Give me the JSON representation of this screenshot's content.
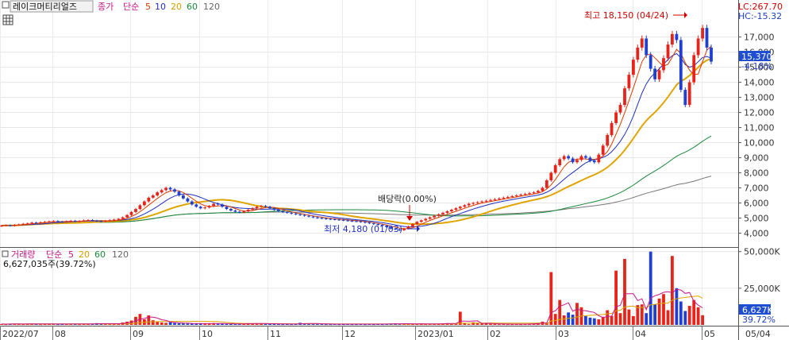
{
  "chart_data": [
    {
      "type": "candlestick",
      "title": "레이크머티리얼즈",
      "legend": {
        "label": "종가",
        "mode": "단순",
        "periods": [
          "5",
          "10",
          "20",
          "60",
          "120"
        ]
      },
      "top_right": {
        "lc": "LC:267.70",
        "hc": "HC:-15.32"
      },
      "price_axis": [
        "17,000",
        "16,000",
        "15,000",
        "14,000",
        "13,000",
        "12,000",
        "11,000",
        "10,000",
        "9,000",
        "8,000",
        "7,000",
        "6,000",
        "5,000",
        "4,000"
      ],
      "ylim": [
        3500,
        18400
      ],
      "current": {
        "price": "15,370",
        "change": "-4.18%"
      },
      "annotations": {
        "high": "최고 18,150 (04/24)",
        "low": "최저 4,180 (01/03)",
        "dividend": "배당락(0.00%)"
      },
      "x_ticks": [
        "2022/07",
        "08",
        "09",
        "10",
        "11",
        "12",
        "2023/01",
        "02",
        "03",
        "04",
        "05",
        "05/04"
      ],
      "close_series": [
        4500,
        4520,
        4490,
        4550,
        4580,
        4620,
        4650,
        4700,
        4680,
        4720,
        4750,
        4780,
        4800,
        4760,
        4740,
        4790,
        4820,
        4780,
        4810,
        4850,
        4870,
        4830,
        4800,
        4780,
        4820,
        4860,
        4900,
        4950,
        5050,
        5200,
        5400,
        5600,
        5850,
        6100,
        6350,
        6500,
        6700,
        6850,
        7000,
        6900,
        6750,
        6500,
        6300,
        6100,
        5900,
        5750,
        5650,
        5700,
        5800,
        5950,
        5900,
        5750,
        5600,
        5500,
        5420,
        5380,
        5450,
        5550,
        5650,
        5750,
        5800,
        5750,
        5650,
        5550,
        5450,
        5400,
        5350,
        5300,
        5250,
        5200,
        5150,
        5100,
        5050,
        5000,
        4980,
        4950,
        4930,
        4900,
        4880,
        4850,
        4820,
        4800,
        4780,
        4750,
        4700,
        4650,
        4600,
        4550,
        4500,
        4400,
        4300,
        4250,
        4200,
        4300,
        4450,
        4600,
        4750,
        4850,
        4950,
        5050,
        5150,
        5250,
        5350,
        5450,
        5550,
        5650,
        5750,
        5850,
        5950,
        6000,
        6050,
        6100,
        6150,
        6200,
        6250,
        6300,
        6350,
        6400,
        6450,
        6500,
        6550,
        6600,
        6650,
        6700,
        6800,
        7000,
        7500,
        8000,
        8500,
        8900,
        9100,
        8950,
        8700,
        8850,
        9100,
        9000,
        8800,
        8700,
        9200,
        9800,
        10500,
        11300,
        12000,
        12500,
        13600,
        14500,
        15500,
        16300,
        16900,
        15800,
        14900,
        14200,
        14800,
        15600,
        16500,
        17200,
        16800,
        13500,
        12500,
        14000,
        15800,
        16900,
        17600,
        16300,
        15370
      ],
      "volume_axis": [
        "50,000K",
        "25,000K"
      ],
      "volume_legend": {
        "label": "거래량",
        "mode": "단순",
        "periods": [
          "5",
          "20",
          "60",
          "120"
        ]
      },
      "current_volume": {
        "label": "6,627,035주(39.72%)",
        "value": "6,627K",
        "pct": "39.72%"
      },
      "volume_values": [
        0.6,
        0.5,
        0.7,
        0.8,
        0.6,
        0.5,
        0.7,
        0.9,
        0.6,
        0.5,
        0.8,
        0.7,
        0.6,
        0.5,
        0.6,
        0.7,
        0.8,
        0.6,
        0.5,
        0.6,
        0.7,
        0.9,
        1.2,
        0.8,
        0.6,
        0.7,
        0.9,
        1.1,
        1.6,
        2.2,
        3.0,
        5.5,
        7.5,
        3.8,
        6.5,
        3.2,
        2.4,
        1.6,
        1.4,
        1.8,
        1.3,
        1.1,
        1.0,
        0.9,
        0.8,
        0.9,
        1.0,
        1.1,
        0.8,
        1.2,
        0.9,
        0.8,
        0.7,
        0.6,
        0.6,
        0.7,
        0.9,
        1.2,
        0.8,
        1.0,
        0.9,
        0.8,
        0.6,
        0.7,
        0.6,
        0.5,
        0.6,
        0.5,
        0.7,
        1.4,
        1.0,
        0.9,
        0.7,
        0.6,
        0.6,
        0.5,
        0.5,
        0.6,
        0.5,
        0.5,
        0.6,
        0.5,
        0.5,
        0.6,
        0.5,
        0.6,
        0.5,
        0.6,
        0.5,
        0.7,
        0.9,
        1.1,
        0.6,
        0.8,
        0.7,
        0.6,
        0.8,
        0.9,
        0.6,
        0.7,
        0.6,
        0.8,
        1.0,
        1.2,
        0.9,
        0.7,
        9.0,
        1.2,
        0.6,
        1.8,
        1.1,
        0.8,
        0.9,
        0.7,
        0.6,
        0.5,
        0.6,
        0.5,
        0.5,
        0.6,
        0.5,
        0.7,
        0.8,
        0.9,
        1.4,
        2.2,
        1.4,
        36.0,
        7.5,
        17.0,
        6.5,
        8.5,
        7.0,
        15.0,
        12.0,
        6.0,
        5.0,
        4.5,
        3.8,
        5.5,
        10.0,
        6.0,
        37.0,
        8.0,
        45.0,
        10.5,
        6.0,
        13.5,
        14.0,
        8.0,
        50.0,
        14.0,
        18.0,
        21.0,
        10.0,
        47.0,
        25.0,
        16.0,
        9.5,
        13.0,
        17.0,
        12.0,
        6.6
      ]
    }
  ]
}
